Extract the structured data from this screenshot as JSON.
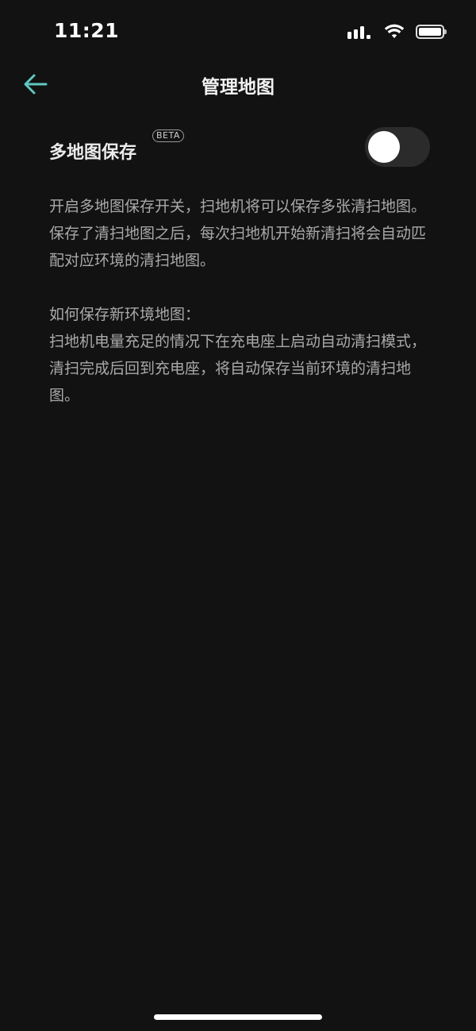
{
  "status_bar": {
    "time": "11:21",
    "icons": [
      "cellular-signal-icon",
      "wifi-icon",
      "battery-icon"
    ]
  },
  "header": {
    "title": "管理地图",
    "back_icon": "arrow-left-icon",
    "accent_color": "#5fc8c0"
  },
  "setting": {
    "label": "多地图保存",
    "badge": "BETA",
    "toggle_on": false
  },
  "description": {
    "paragraph1": "开启多地图保存开关，扫地机将可以保存多张清扫地图。保存了清扫地图之后，每次扫地机开始新清扫将会自动匹配对应环境的清扫地图。",
    "heading2": "如何保存新环境地图：",
    "paragraph2": "扫地机电量充足的情况下在充电座上启动自动清扫模式，清扫完成后回到充电座，将自动保存当前环境的清扫地图。"
  }
}
